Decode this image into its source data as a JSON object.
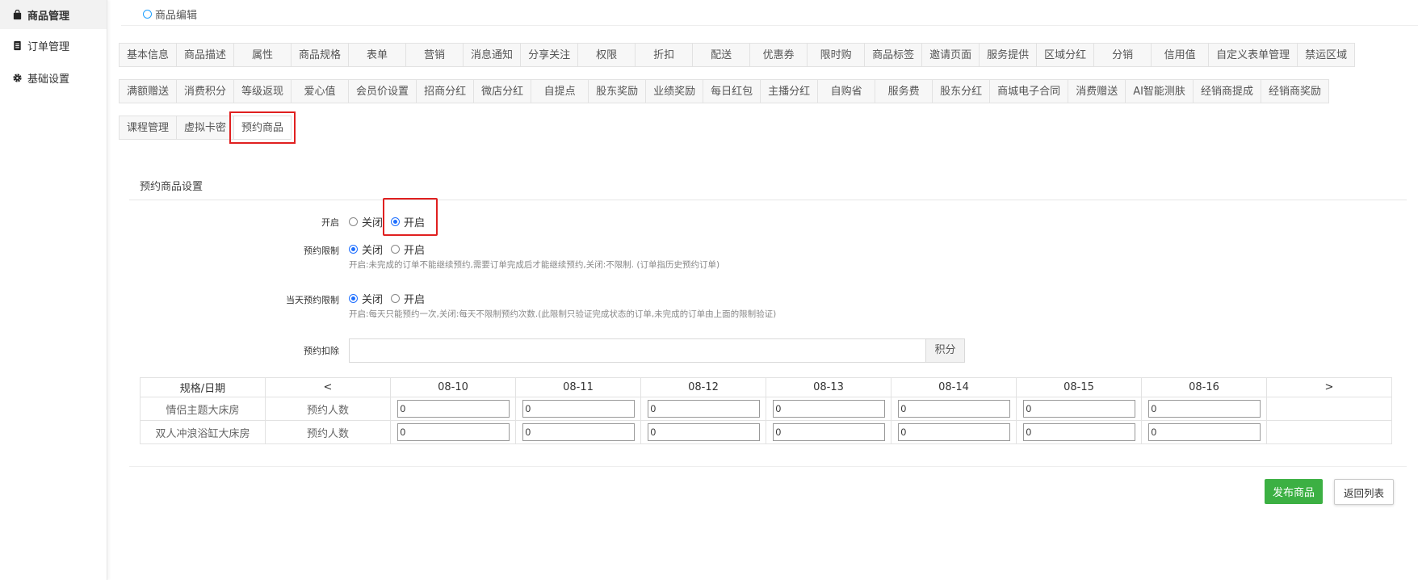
{
  "sidebar": {
    "items": [
      {
        "label": "商品管理",
        "icon": "bag-icon"
      },
      {
        "label": "订单管理",
        "icon": "document-icon"
      },
      {
        "label": "基础设置",
        "icon": "gear-icon"
      }
    ]
  },
  "breadcrumb": {
    "label": "商品编辑"
  },
  "tabs": {
    "row1": [
      "基本信息",
      "商品描述",
      "属性",
      "商品规格",
      "表单",
      "营销",
      "消息通知",
      "分享关注",
      "权限",
      "折扣",
      "配送",
      "优惠券",
      "限时购",
      "商品标签",
      "邀请页面",
      "服务提供",
      "区域分红",
      "分销",
      "信用值",
      "自定义表单管理",
      "禁运区域"
    ],
    "row2": [
      "满额赠送",
      "消费积分",
      "等级返现",
      "爱心值",
      "会员价设置",
      "招商分红",
      "微店分红",
      "自提点",
      "股东奖励",
      "业绩奖励",
      "每日红包",
      "主播分红",
      "自购省",
      "服务费",
      "股东分红",
      "商城电子合同",
      "消费赠送",
      "AI智能测肤",
      "经销商提成",
      "经销商奖励"
    ],
    "row3": [
      "课程管理",
      "虚拟卡密",
      "预约商品"
    ],
    "active": "预约商品"
  },
  "section": {
    "title": "预约商品设置"
  },
  "form": {
    "enable": {
      "label": "开启",
      "off": "关闭",
      "on": "开启",
      "selected": "on"
    },
    "limit": {
      "label": "预约限制",
      "off": "关闭",
      "on": "开启",
      "selected": "off",
      "hint": "开启:未完成的订单不能继续预约,需要订单完成后才能继续预约,关闭:不限制. (订单指历史预约订单)"
    },
    "daily": {
      "label": "当天预约限制",
      "off": "关闭",
      "on": "开启",
      "selected": "off",
      "hint": "开启:每天只能预约一次,关闭:每天不限制预约次数.(此限制只验证完成状态的订单,未完成的订单由上面的限制验证)"
    },
    "deduct": {
      "label": "预约扣除",
      "value": "",
      "unit": "积分"
    }
  },
  "table": {
    "header": {
      "spec": "规格/日期",
      "prev": "<",
      "next": ">",
      "dates": [
        "08-10",
        "08-11",
        "08-12",
        "08-13",
        "08-14",
        "08-15",
        "08-16"
      ]
    },
    "rows": [
      {
        "name": "情侣主题大床房",
        "type": "预约人数",
        "values": [
          "0",
          "0",
          "0",
          "0",
          "0",
          "0",
          "0"
        ]
      },
      {
        "name": "双人冲浪浴缸大床房",
        "type": "预约人数",
        "values": [
          "0",
          "0",
          "0",
          "0",
          "0",
          "0",
          "0"
        ]
      }
    ]
  },
  "buttons": {
    "publish": "发布商品",
    "back": "返回列表"
  }
}
